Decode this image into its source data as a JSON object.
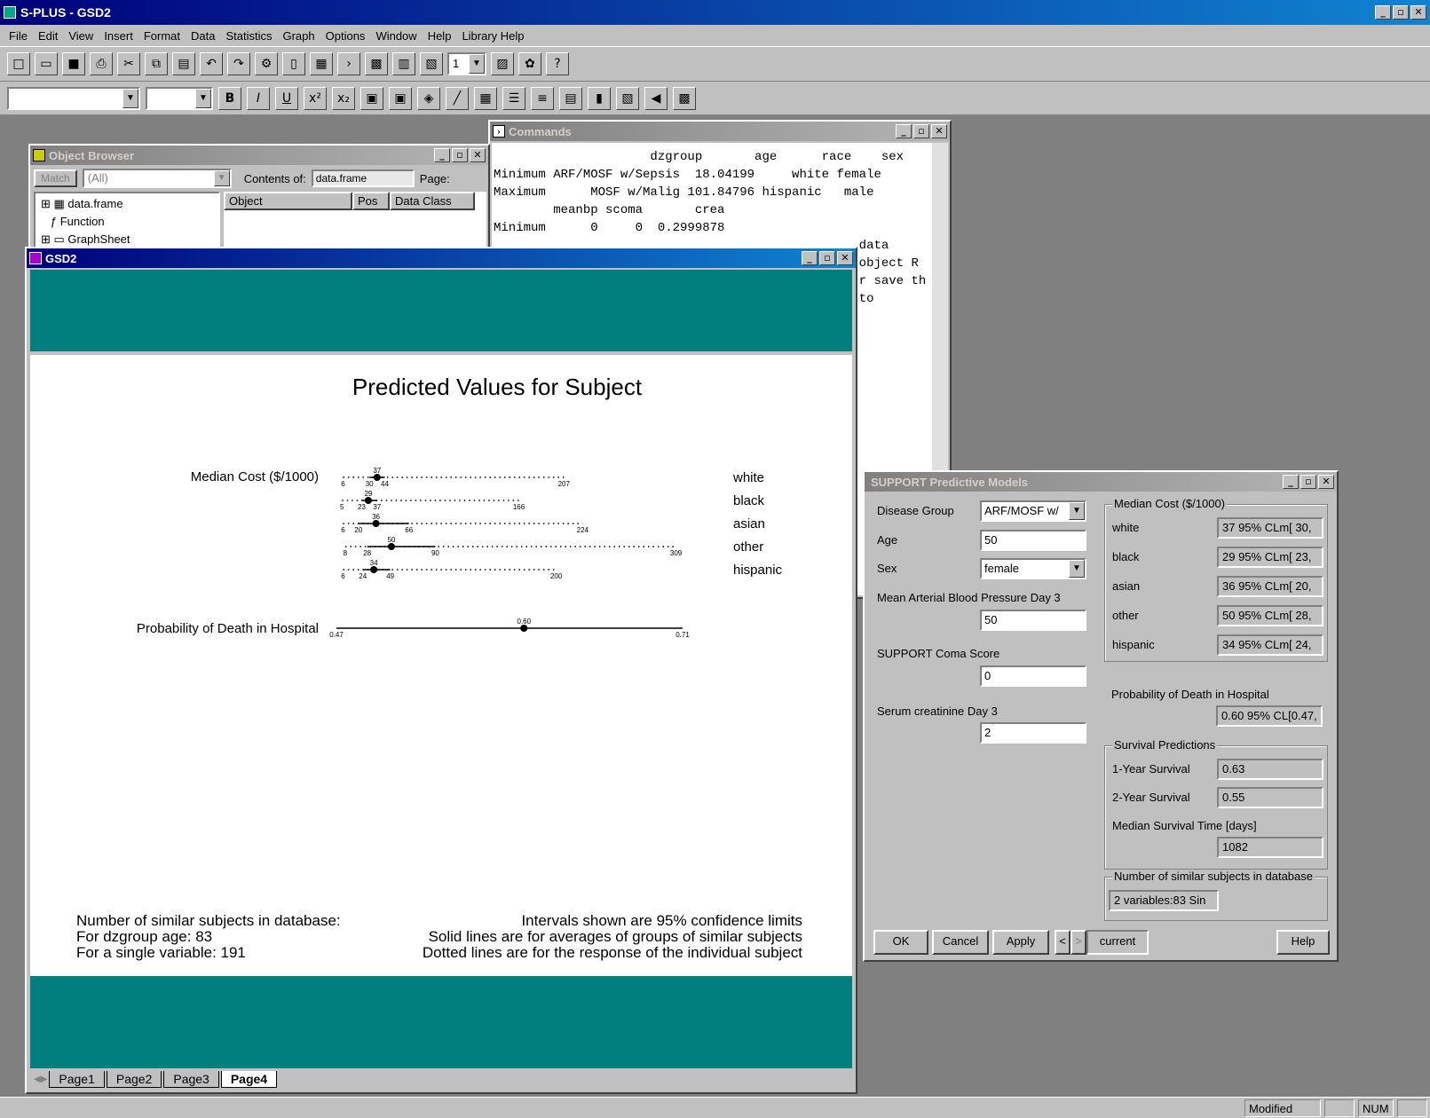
{
  "app": {
    "title": "S-PLUS - GSD2",
    "controls": [
      "_",
      "▫",
      "✕"
    ]
  },
  "menu": [
    "File",
    "Edit",
    "View",
    "Insert",
    "Format",
    "Data",
    "Statistics",
    "Graph",
    "Options",
    "Window",
    "Help",
    "Library Help"
  ],
  "toolbar": {
    "page_select": "1"
  },
  "toolbar2": {
    "bold": "B",
    "italic": "I",
    "underline": "U"
  },
  "commands": {
    "title": "Commands",
    "lines": [
      "                     dzgroup       age      race    sex",
      "Minimum ARF/MOSF w/Sepsis  18.04199     white female",
      "Maximum      MOSF w/Malig 101.84796 hispanic   male",
      "        meanbp scoma       crea",
      "Minimum      0     0  0.2999878",
      "",
      "",
      "",
      "                                                 data",
      "                                                 object R",
      "",
      "",
      "                                                 r save th",
      "",
      "                                                 to"
    ]
  },
  "object_browser": {
    "title": "Object Browser",
    "match": "Match",
    "filter": "(All)",
    "contents_label": "Contents of:",
    "contents_value": "data.frame",
    "page_label": "Page:",
    "tree": [
      "data.frame",
      "Function",
      "GraphSheet"
    ],
    "columns": [
      "Object",
      "Pos",
      "Data Class"
    ]
  },
  "gsd2": {
    "title": "GSD2",
    "tabs": [
      "Page1",
      "Page2",
      "Page3",
      "Page4"
    ],
    "active_tab": "Page4"
  },
  "chart_data": {
    "type": "dot-interval",
    "title": "Predicted Values for Subject",
    "panels": [
      {
        "label": "Median Cost ($/1000)",
        "series": [
          {
            "name": "white",
            "estimate": 37,
            "lower": 30,
            "upper": 44,
            "ind_lower": 6,
            "ind_upper": 207
          },
          {
            "name": "black",
            "estimate": 29,
            "lower": 23,
            "upper": 37,
            "ind_lower": 5,
            "ind_upper": 166
          },
          {
            "name": "asian",
            "estimate": 36,
            "lower": 20,
            "upper": 66,
            "ind_lower": 6,
            "ind_upper": 224
          },
          {
            "name": "other",
            "estimate": 50,
            "lower": 28,
            "upper": 90,
            "ind_lower": 8,
            "ind_upper": 309
          },
          {
            "name": "hispanic",
            "estimate": 34,
            "lower": 24,
            "upper": 49,
            "ind_lower": 6,
            "ind_upper": 200
          }
        ]
      },
      {
        "label": "Probability of Death in Hospital",
        "series": [
          {
            "name": "",
            "estimate": 0.6,
            "lower": 0.47,
            "upper": 0.71,
            "est_label": "0.60",
            "lower_label": "0.47",
            "upper_label": "0.71"
          }
        ]
      }
    ],
    "notes_left": [
      "Number of similar subjects in database:",
      "For dzgroup age: 83",
      "For a single variable: 191"
    ],
    "notes_right": [
      "Intervals shown are 95% confidence limits",
      "Solid lines are for averages of groups of similar subjects",
      "Dotted lines are for the response of the individual subject"
    ]
  },
  "support": {
    "title": "SUPPORT Predictive Models",
    "inputs": {
      "disease_group_label": "Disease Group",
      "disease_group": "ARF/MOSF w/",
      "age_label": "Age",
      "age": "50",
      "sex_label": "Sex",
      "sex": "female",
      "meanbp_label": "Mean Arterial Blood Pressure Day 3",
      "meanbp": "50",
      "coma_label": "SUPPORT Coma Score",
      "coma": "0",
      "crea_label": "Serum creatinine Day 3",
      "crea": "2"
    },
    "median_cost": {
      "title": "Median Cost ($/1000)",
      "rows": [
        {
          "label": "white",
          "value": "37  95% CLm[ 30,"
        },
        {
          "label": "black",
          "value": "29  95% CLm[ 23,"
        },
        {
          "label": "asian",
          "value": "36  95% CLm[ 20,"
        },
        {
          "label": "other",
          "value": "50  95% CLm[ 28,"
        },
        {
          "label": "hispanic",
          "value": "34  95% CLm[ 24,"
        }
      ]
    },
    "prob_death": {
      "label": "Probability of Death in Hospital",
      "value": "0.60  95% CL[0.47,"
    },
    "survival": {
      "title": "Survival Predictions",
      "one_year_label": "1-Year Survival",
      "one_year": "0.63",
      "two_year_label": "2-Year Survival",
      "two_year": "0.55",
      "median_label": "Median Survival Time [days]",
      "median": "1082"
    },
    "similar": {
      "title": "Number of similar subjects in database",
      "value": "2 variables:83  Sin"
    },
    "buttons": {
      "ok": "OK",
      "cancel": "Cancel",
      "apply": "Apply",
      "prev": "<",
      "next": ">",
      "current": "current",
      "help": "Help"
    }
  },
  "status": {
    "modified": "Modified",
    "num": "NUM"
  }
}
